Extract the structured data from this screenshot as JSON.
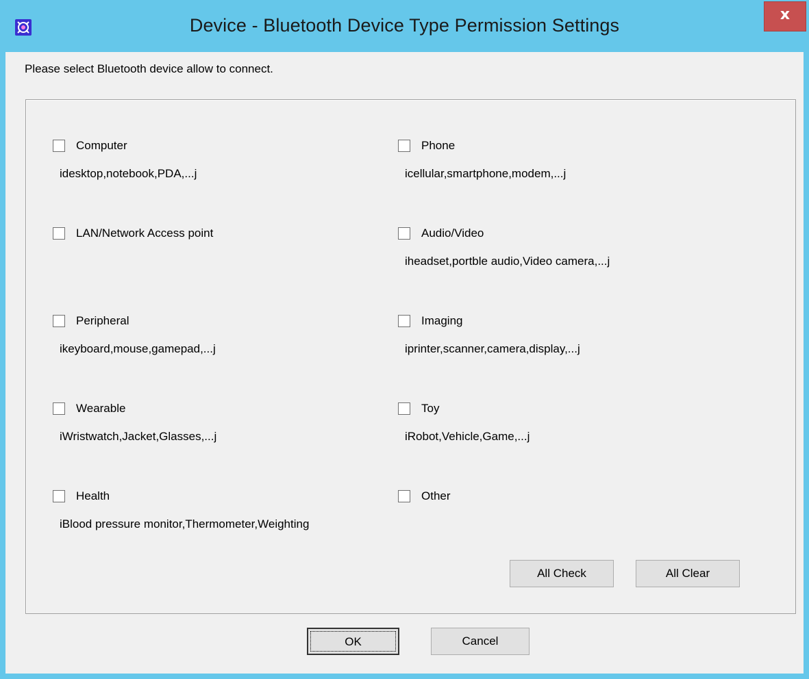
{
  "window": {
    "title": "Device - Bluetooth Device Type Permission Settings",
    "close_label": "x",
    "titlebar_color": "#65c7ea",
    "close_color": "#c75050"
  },
  "instruction": "Please select Bluetooth device allow to connect.",
  "devices": {
    "computer": {
      "label": "Computer",
      "desc": "idesktop,notebook,PDA,...j",
      "checked": false
    },
    "phone": {
      "label": "Phone",
      "desc": "icellular,smartphone,modem,...j",
      "checked": false
    },
    "lan": {
      "label": "LAN/Network Access point",
      "checked": false
    },
    "audio_video": {
      "label": "Audio/Video",
      "desc": "iheadset,portble audio,Video camera,...j",
      "checked": false
    },
    "peripheral": {
      "label": "Peripheral",
      "desc": "ikeyboard,mouse,gamepad,...j",
      "checked": false
    },
    "imaging": {
      "label": "Imaging",
      "desc": "iprinter,scanner,camera,display,...j",
      "checked": false
    },
    "wearable": {
      "label": "Wearable",
      "desc": "iWristwatch,Jacket,Glasses,...j",
      "checked": false
    },
    "toy": {
      "label": "Toy",
      "desc": "iRobot,Vehicle,Game,...j",
      "checked": false
    },
    "health": {
      "label": "Health",
      "desc": "iBlood pressure monitor,Thermometer,Weighting",
      "checked": false
    },
    "other": {
      "label": "Other",
      "checked": false
    }
  },
  "buttons": {
    "all_check": "All Check",
    "all_clear": "All Clear",
    "ok": "OK",
    "cancel": "Cancel"
  }
}
